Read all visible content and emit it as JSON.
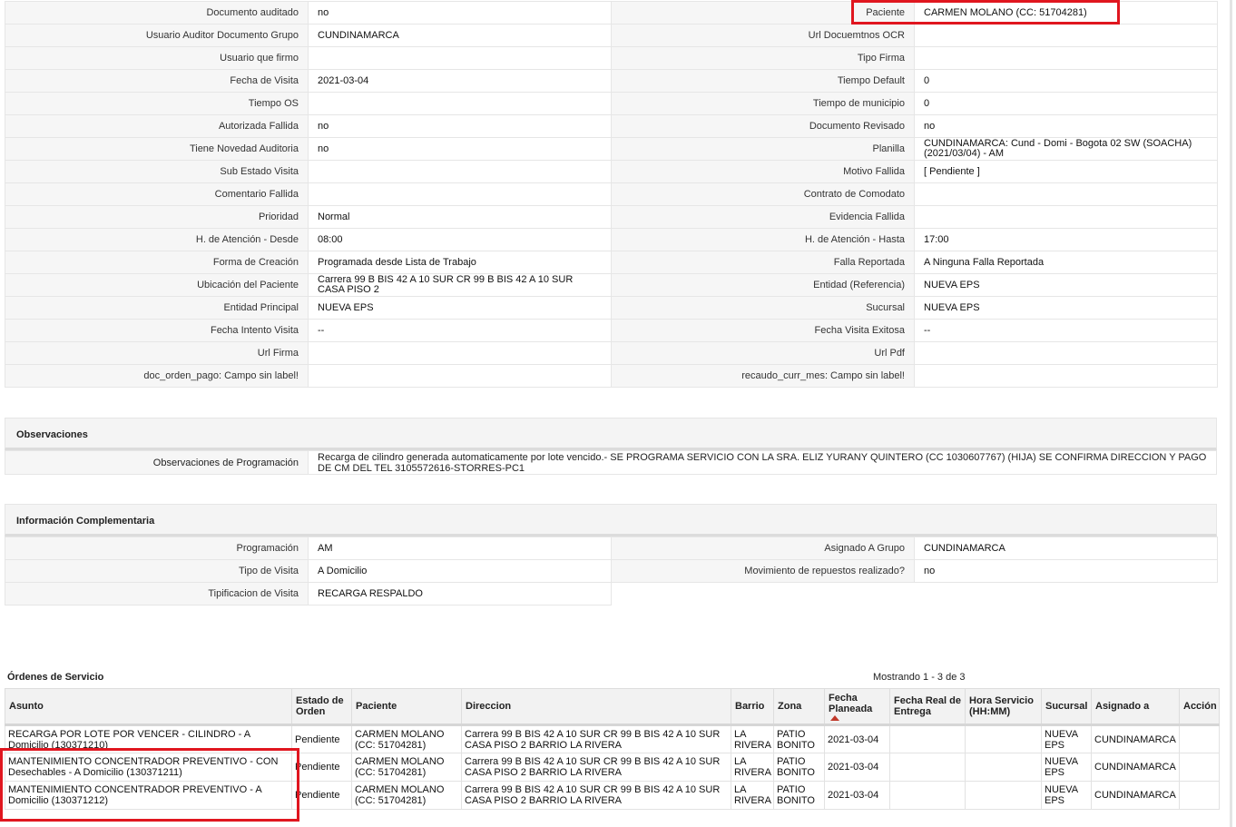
{
  "details": [
    [
      "Documento auditado",
      "no",
      "Paciente",
      "CARMEN MOLANO (CC: 51704281)"
    ],
    [
      "Usuario Auditor Documento Grupo",
      "CUNDINAMARCA",
      "Url Docuemtnos OCR",
      ""
    ],
    [
      "Usuario que firmo",
      "",
      "Tipo Firma",
      ""
    ],
    [
      "Fecha de Visita",
      "2021-03-04",
      "Tiempo Default",
      "0"
    ],
    [
      "Tiempo OS",
      "",
      "Tiempo de municipio",
      "0"
    ],
    [
      "Autorizada Fallida",
      "no",
      "Documento Revisado",
      "no"
    ],
    [
      "Tiene Novedad Auditoria",
      "no",
      "Planilla",
      "CUNDINAMARCA: Cund - Domi - Bogota 02 SW (SOACHA) (2021/03/04) - AM"
    ],
    [
      "Sub Estado Visita",
      "",
      "Motivo Fallida",
      "[ Pendiente ]"
    ],
    [
      "Comentario Fallida",
      "",
      "Contrato de Comodato",
      ""
    ],
    [
      "Prioridad",
      "Normal",
      "Evidencia Fallida",
      ""
    ],
    [
      "H. de Atención - Desde",
      "08:00",
      "H. de Atención - Hasta",
      "17:00"
    ],
    [
      "Forma de Creación",
      "Programada desde Lista de Trabajo",
      "Falla Reportada",
      "A Ninguna Falla Reportada"
    ],
    [
      "Ubicación del Paciente",
      "Carrera 99 B BIS 42 A 10 SUR CR 99 B BIS 42 A 10 SUR CASA PISO 2",
      "Entidad (Referencia)",
      "NUEVA EPS"
    ],
    [
      "Entidad Principal",
      "NUEVA EPS",
      "Sucursal",
      "NUEVA EPS"
    ],
    [
      "Fecha Intento Visita",
      "--",
      "Fecha Visita Exitosa",
      "--"
    ],
    [
      "Url Firma",
      "",
      "Url Pdf",
      ""
    ],
    [
      "doc_orden_pago: Campo sin label!",
      "",
      "recaudo_curr_mes: Campo sin label!",
      ""
    ]
  ],
  "observaciones": {
    "title": "Observaciones",
    "label": "Observaciones de Programación",
    "value": "Recarga de cilindro generada automaticamente por lote vencido.- SE PROGRAMA SERVICIO CON LA SRA. ELIZ YURANY QUINTERO (CC 1030607767) (HIJA) SE CONFIRMA DIRECCION Y PAGO DE CM DEL TEL 3105572616-STORRES-PC1"
  },
  "complementaria": {
    "title": "Información Complementaria",
    "rows": [
      [
        "Programación",
        "AM",
        "Asignado A Grupo",
        "CUNDINAMARCA"
      ],
      [
        "Tipo de Visita",
        "A Domicilio",
        "Movimiento de repuestos realizado?",
        "no"
      ],
      [
        "Tipificacion de Visita",
        "RECARGA RESPALDO"
      ]
    ]
  },
  "orders": {
    "title": "Órdenes de Servicio",
    "count": "Mostrando 1 - 3 de 3",
    "headers": [
      "Asunto",
      "Estado de Orden",
      "Paciente",
      "Direccion",
      "Barrio",
      "Zona",
      "Fecha Planeada",
      "Fecha Real de Entrega",
      "Hora Servicio (HH:MM)",
      "Sucursal",
      "Asignado a",
      "Acción"
    ],
    "rows": [
      [
        "RECARGA POR LOTE POR VENCER - CILINDRO - A Domicilio (130371210)",
        "Pendiente",
        "CARMEN MOLANO (CC: 51704281)",
        "Carrera 99 B BIS 42 A 10 SUR CR 99 B BIS 42 A 10 SUR CASA PISO 2 BARRIO LA RIVERA",
        "LA RIVERA",
        "PATIO BONITO",
        "2021-03-04",
        "",
        "",
        "NUEVA EPS",
        "CUNDINAMARCA",
        ""
      ],
      [
        "MANTENIMIENTO CONCENTRADOR PREVENTIVO - CON Desechables - A Domicilio (130371211)",
        "Pendiente",
        "CARMEN MOLANO (CC: 51704281)",
        "Carrera 99 B BIS 42 A 10 SUR CR 99 B BIS 42 A 10 SUR CASA PISO 2 BARRIO LA RIVERA",
        "LA RIVERA",
        "PATIO BONITO",
        "2021-03-04",
        "",
        "",
        "NUEVA EPS",
        "CUNDINAMARCA",
        ""
      ],
      [
        "MANTENIMIENTO CONCENTRADOR PREVENTIVO - A Domicilio (130371212)",
        "Pendiente",
        "CARMEN MOLANO (CC: 51704281)",
        "Carrera 99 B BIS 42 A 10 SUR CR 99 B BIS 42 A 10 SUR CASA PISO 2 BARRIO LA RIVERA",
        "LA RIVERA",
        "PATIO BONITO",
        "2021-03-04",
        "",
        "",
        "NUEVA EPS",
        "CUNDINAMARCA",
        ""
      ]
    ]
  },
  "colors": {
    "highlight": "#e0161f",
    "sort_arrow": "#c0392b",
    "label_bg": "#f6f6f6",
    "header_bg": "#f4f4f4"
  }
}
